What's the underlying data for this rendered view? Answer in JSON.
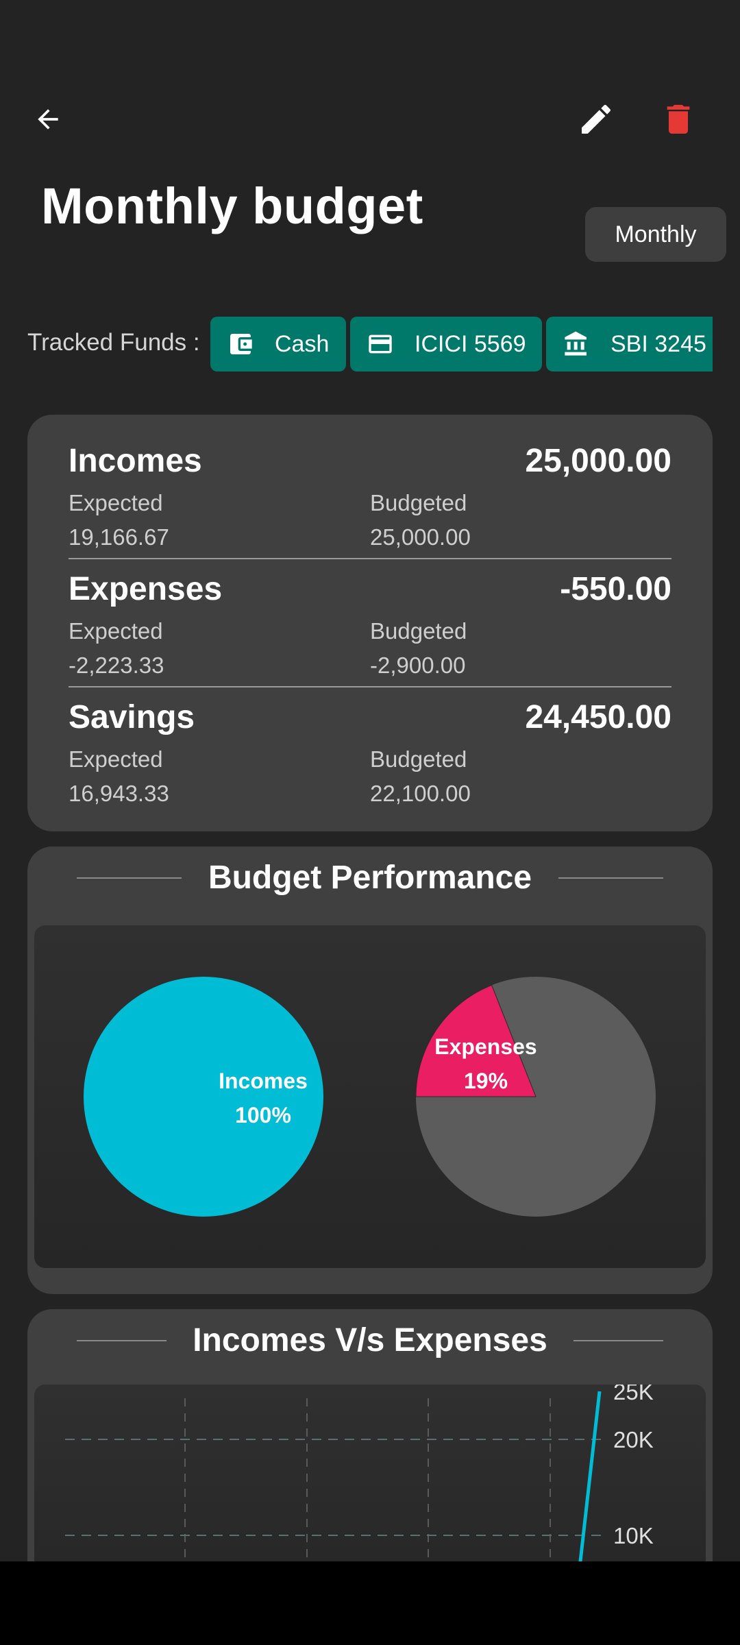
{
  "header": {
    "back_icon": "arrow-left-icon",
    "edit_icon": "pencil-icon",
    "delete_icon": "trash-icon",
    "delete_color": "#e53935"
  },
  "title": "Monthly budget",
  "period": "Monthly",
  "tracked_funds": {
    "label": "Tracked Funds :",
    "funds": [
      {
        "name": "Cash",
        "icon": "wallet-icon"
      },
      {
        "name": "ICICI 5569",
        "icon": "credit-card-icon"
      },
      {
        "name": "SBI 3245",
        "icon": "bank-icon"
      }
    ],
    "chip_color": "#00796b"
  },
  "summary": {
    "incomes": {
      "title": "Incomes",
      "total": "25,000.00",
      "expected_label": "Expected",
      "expected": "19,166.67",
      "budgeted_label": "Budgeted",
      "budgeted": "25,000.00"
    },
    "expenses": {
      "title": "Expenses",
      "total": "-550.00",
      "expected_label": "Expected",
      "expected": "-2,223.33",
      "budgeted_label": "Budgeted",
      "budgeted": "-2,900.00"
    },
    "savings": {
      "title": "Savings",
      "total": "24,450.00",
      "expected_label": "Expected",
      "expected": "16,943.33",
      "budgeted_label": "Budgeted",
      "budgeted": "22,100.00"
    }
  },
  "budget_performance": {
    "title": "Budget Performance",
    "incomes_label": "Incomes",
    "incomes_pct": "100%",
    "expenses_label": "Expenses",
    "expenses_pct": "19%"
  },
  "incomes_vs_expenses": {
    "title": "Incomes V/s Expenses",
    "income_color": "#00bcd4"
  },
  "chart_data": [
    {
      "type": "pie",
      "labels": [
        "Incomes"
      ],
      "values": [
        100
      ],
      "colors": [
        "#00bcd4"
      ]
    },
    {
      "type": "pie",
      "labels": [
        "Expenses",
        ""
      ],
      "values": [
        19,
        81
      ],
      "colors": [
        "#e91e63",
        "#5c5c5c"
      ]
    },
    {
      "type": "line",
      "title": "Incomes V/s Expenses",
      "y_tick_labels": [
        "25K",
        "20K",
        "10K"
      ],
      "y_ticks": [
        25000,
        20000,
        10000
      ],
      "grid": true,
      "series": [
        {
          "values": [
            0,
            0,
            0,
            0,
            25000
          ]
        }
      ]
    }
  ]
}
